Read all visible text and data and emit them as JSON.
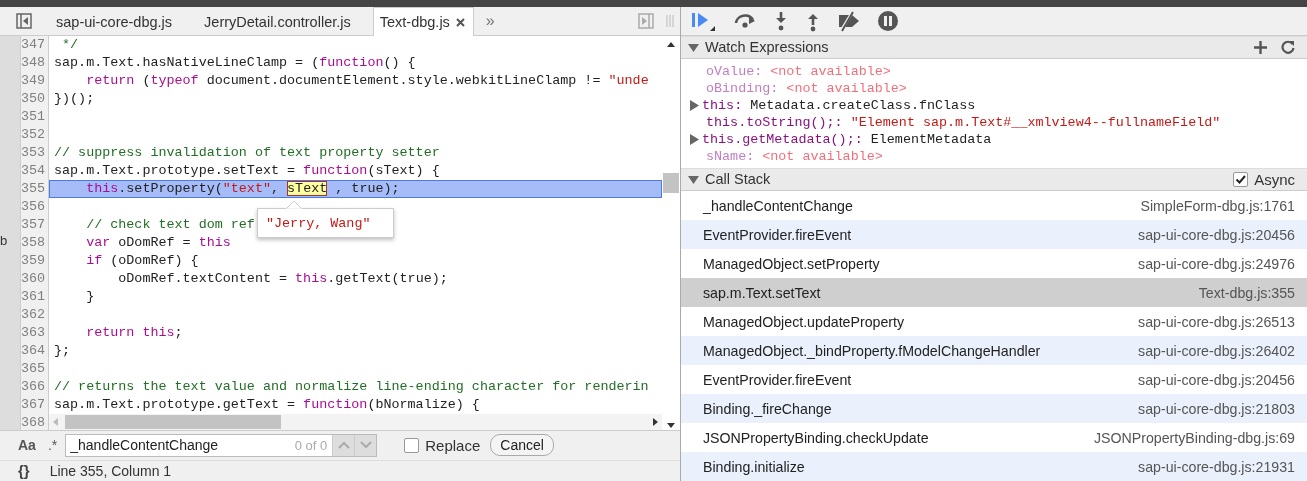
{
  "editor": {
    "tabs": [
      {
        "label": "sap-ui-core-dbg.js",
        "selected": false
      },
      {
        "label": "JerryDetail.controller.js",
        "selected": false
      },
      {
        "label": "Text-dbg.js",
        "selected": true
      }
    ],
    "overflow": "»",
    "side_text": "b",
    "lines": [
      {
        "number": "347",
        "tokens": [
          {
            "kind": "comment",
            "text": " */"
          }
        ]
      },
      {
        "number": "348",
        "tokens": [
          {
            "kind": "plain",
            "text": "sap.m.Text.hasNativeLineClamp = ("
          },
          {
            "kind": "keyword",
            "text": "function"
          },
          {
            "kind": "plain",
            "text": "() {"
          }
        ]
      },
      {
        "number": "349",
        "tokens": [
          {
            "kind": "keyword",
            "text": "    return"
          },
          {
            "kind": "plain",
            "text": " ("
          },
          {
            "kind": "keyword",
            "text": "typeof"
          },
          {
            "kind": "plain",
            "text": " document.documentElement.style.webkitLineClamp != "
          },
          {
            "kind": "string",
            "text": "\"unde"
          }
        ]
      },
      {
        "number": "350",
        "tokens": [
          {
            "kind": "plain",
            "text": "})();"
          }
        ]
      },
      {
        "number": "351"
      },
      {
        "number": "352"
      },
      {
        "number": "353",
        "tokens": [
          {
            "kind": "comment",
            "text": "// suppress invalidation of text property setter"
          }
        ]
      },
      {
        "number": "354",
        "tokens": [
          {
            "kind": "plain",
            "text": "sap.m.Text.prototype.setText = "
          },
          {
            "kind": "keyword",
            "text": "function"
          },
          {
            "kind": "plain",
            "text": "(sText) {"
          }
        ]
      },
      {
        "number": "355",
        "current": true,
        "tokens": [
          {
            "kind": "keyword",
            "text": "    this"
          },
          {
            "kind": "plain",
            "text": ".setProperty("
          },
          {
            "kind": "string",
            "text": "\"text\""
          },
          {
            "kind": "plain",
            "text": ", "
          },
          {
            "kind": "hover",
            "text": "sText"
          },
          {
            "kind": "plain",
            "text": " , true);"
          }
        ]
      },
      {
        "number": "356"
      },
      {
        "number": "357",
        "tokens": [
          {
            "kind": "comment",
            "text": "    // check text dom ref"
          }
        ]
      },
      {
        "number": "358",
        "tokens": [
          {
            "kind": "keyword",
            "text": "    var"
          },
          {
            "kind": "plain",
            "text": " oDomRef = "
          },
          {
            "kind": "keyword",
            "text": "this"
          }
        ]
      },
      {
        "number": "359",
        "tokens": [
          {
            "kind": "keyword",
            "text": "    if"
          },
          {
            "kind": "plain",
            "text": " (oDomRef) {"
          }
        ]
      },
      {
        "number": "360",
        "tokens": [
          {
            "kind": "plain",
            "text": "        oDomRef.textContent = "
          },
          {
            "kind": "keyword",
            "text": "this"
          },
          {
            "kind": "plain",
            "text": ".getText(true);"
          }
        ]
      },
      {
        "number": "361",
        "tokens": [
          {
            "kind": "plain",
            "text": "    }"
          }
        ]
      },
      {
        "number": "362"
      },
      {
        "number": "363",
        "tokens": [
          {
            "kind": "keyword",
            "text": "    return this"
          },
          {
            "kind": "plain",
            "text": ";"
          }
        ]
      },
      {
        "number": "364",
        "tokens": [
          {
            "kind": "plain",
            "text": "};"
          }
        ]
      },
      {
        "number": "365"
      },
      {
        "number": "366",
        "tokens": [
          {
            "kind": "comment",
            "text": "// returns the text value and normalize line-ending character for renderin"
          }
        ]
      },
      {
        "number": "367",
        "tokens": [
          {
            "kind": "plain",
            "text": "sap.m.Text.prototype.getText = "
          },
          {
            "kind": "keyword",
            "text": "function"
          },
          {
            "kind": "plain",
            "text": "(bNormalize) {"
          }
        ]
      }
    ],
    "last_line_number": "368",
    "tooltip": "\"Jerry, Wang\"",
    "search": {
      "case_label": "Aa",
      "regex_label": ".*",
      "value": "_handleContentChange",
      "count": "0 of 0",
      "replace_label": "Replace",
      "replace_checked": false,
      "cancel": "Cancel"
    },
    "status": {
      "pretty_print": "{}",
      "position": "Line 355, Column 1"
    }
  },
  "watch": {
    "title": "Watch Expressions",
    "expanded": true,
    "items": [
      {
        "kind": "unavailable",
        "name": "oValue:",
        "value": "<not available>"
      },
      {
        "kind": "unavailable",
        "name": "oBinding:",
        "value": "<not available>"
      },
      {
        "kind": "object",
        "expanded": false,
        "name": "this:",
        "value": "Metadata.createClass.fnClass"
      },
      {
        "kind": "string",
        "name": "this.toString();:",
        "value": "\"Element sap.m.Text#__xmlview4--fullnameField\""
      },
      {
        "kind": "object",
        "expanded": false,
        "name": "this.getMetadata();:",
        "value": "ElementMetadata"
      },
      {
        "kind": "unavailable",
        "name": "sName:",
        "value": "<not available>"
      }
    ]
  },
  "call_stack": {
    "title": "Call Stack",
    "expanded": true,
    "async_label": "Async",
    "async_checked": true,
    "frames": [
      {
        "function": "_handleContentChange",
        "location": "SimpleForm-dbg.js:1761",
        "selected": false
      },
      {
        "function": "EventProvider.fireEvent",
        "location": "sap-ui-core-dbg.js:20456",
        "selected": false
      },
      {
        "function": "ManagedObject.setProperty",
        "location": "sap-ui-core-dbg.js:24976",
        "selected": false
      },
      {
        "function": "sap.m.Text.setText",
        "location": "Text-dbg.js:355",
        "selected": true
      },
      {
        "function": "ManagedObject.updateProperty",
        "location": "sap-ui-core-dbg.js:26513",
        "selected": false
      },
      {
        "function": "ManagedObject._bindProperty.fModelChangeHandler",
        "location": "sap-ui-core-dbg.js:26402",
        "selected": false
      },
      {
        "function": "EventProvider.fireEvent",
        "location": "sap-ui-core-dbg.js:20456",
        "selected": false
      },
      {
        "function": "Binding._fireChange",
        "location": "sap-ui-core-dbg.js:21803",
        "selected": false
      },
      {
        "function": "JSONPropertyBinding.checkUpdate",
        "location": "JSONPropertyBinding-dbg.js:69",
        "selected": false
      },
      {
        "function": "Binding.initialize",
        "location": "sap-ui-core-dbg.js:21931",
        "selected": false
      }
    ]
  }
}
